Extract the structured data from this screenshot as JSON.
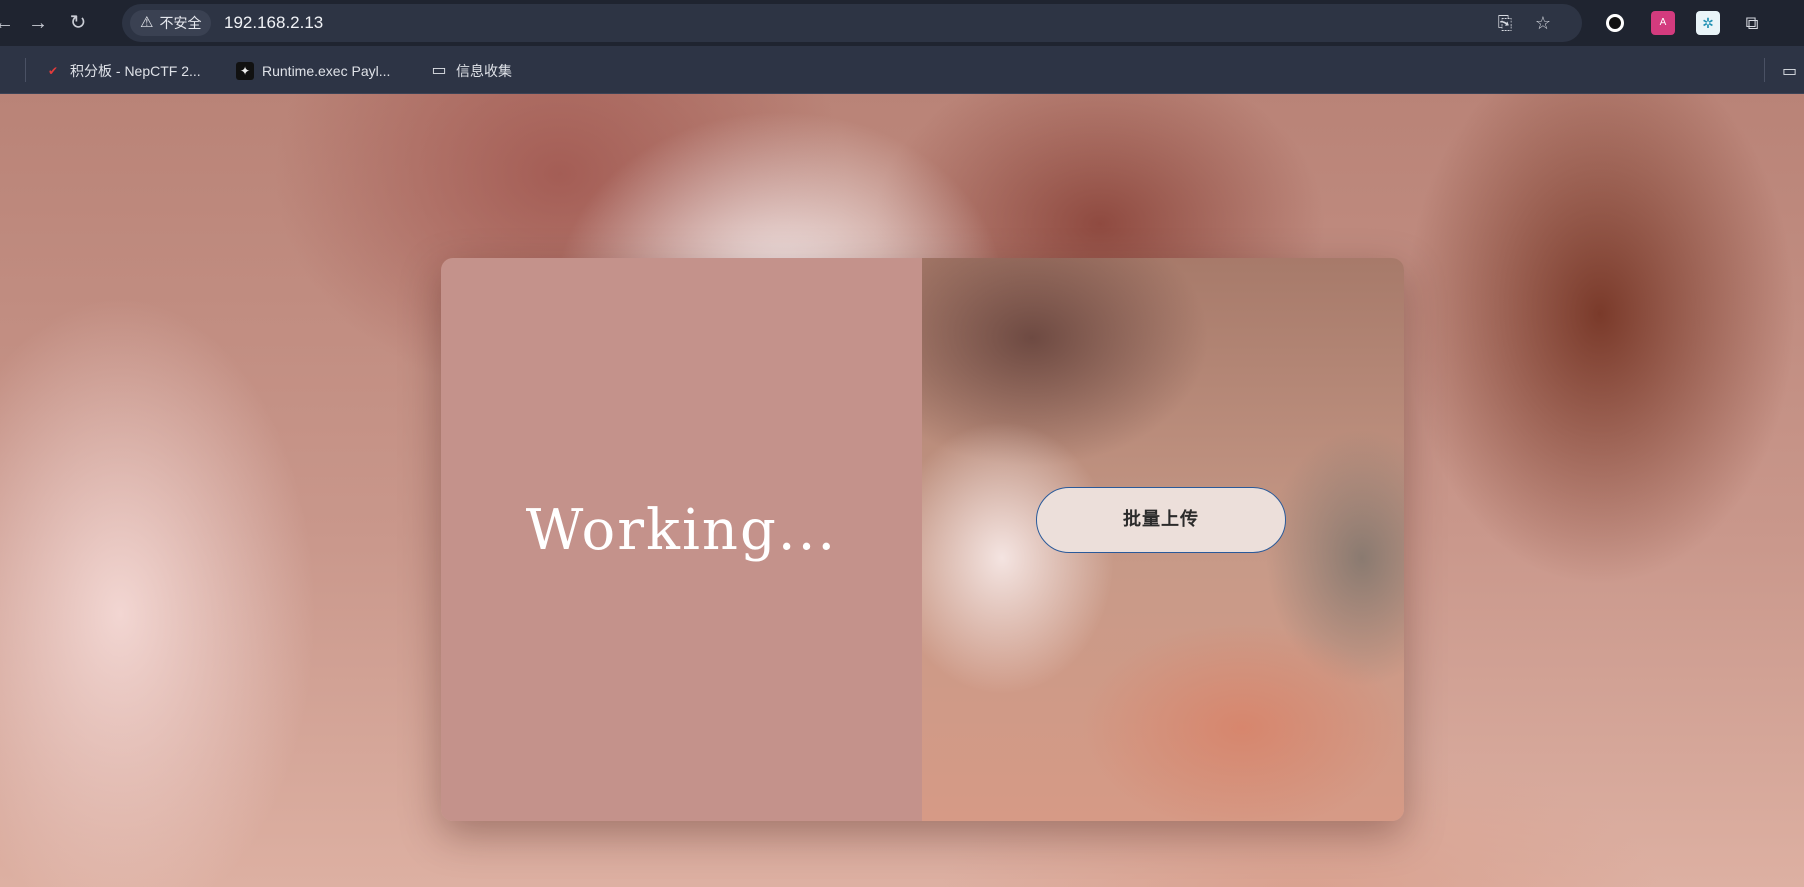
{
  "browser": {
    "nav": {
      "back": "←",
      "forward": "→",
      "reload": "↻"
    },
    "security_label": "不安全",
    "url": "192.168.2.13",
    "bookmarks": [
      {
        "label": "积分板 - NepCTF 2..."
      },
      {
        "label": "Runtime.exec Payl..."
      },
      {
        "label": "信息收集"
      }
    ]
  },
  "page": {
    "status_text": "Working...",
    "upload_button_label": "批量上传"
  },
  "colors": {
    "card_left": "#c4928b",
    "button_bg": "#ecdfda",
    "button_border": "#2a5a9a",
    "browser_chrome": "#1f2430"
  }
}
